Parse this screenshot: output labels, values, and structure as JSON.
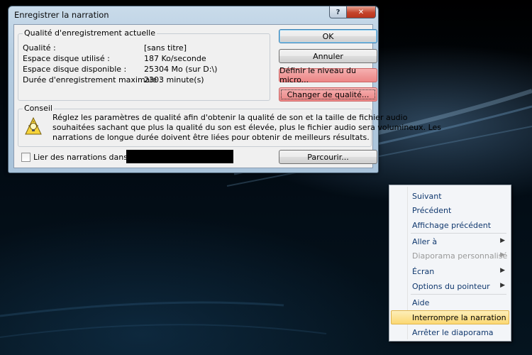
{
  "dialog": {
    "title": "Enregistrer la narration",
    "help_button": "?",
    "close_button": "✕",
    "quality_group": {
      "title": "Qualité d'enregistrement actuelle",
      "rows": [
        {
          "label": "Qualité :",
          "value": "[sans titre]"
        },
        {
          "label": "Espace disque utilisé :",
          "value": "187 Ko/seconde"
        },
        {
          "label": "Espace disque disponible :",
          "value": "25304 Mo (sur D:\\)"
        },
        {
          "label": "Durée d'enregistrement maximale :",
          "value": "2303 minute(s)"
        }
      ]
    },
    "buttons": {
      "ok": "OK",
      "cancel": "Annuler",
      "mic_level": "Définir le niveau du micro...",
      "change_quality": "Changer de qualité...",
      "browse": "Parcourir..."
    },
    "tip_group": {
      "title": "Conseil",
      "text_line1": "Réglez les paramètres de qualité afin d'obtenir la qualité de son et la taille de fichier audio",
      "text_line2": "souhaitées sachant que plus la qualité du son est élevée, plus le fichier audio sera volumineux. Les",
      "text_line3": "narrations de longue durée doivent être liées pour obtenir de meilleurs résultats."
    },
    "link_checkbox_label": "Lier des narrations dans :",
    "link_checkbox_checked": false
  },
  "context_menu": {
    "items": [
      {
        "label": "Suivant",
        "disabled": false,
        "submenu": false
      },
      {
        "label": "Précédent",
        "disabled": false,
        "submenu": false
      },
      {
        "label": "Affichage précédent",
        "disabled": false,
        "submenu": false
      },
      {
        "label": "Aller à",
        "disabled": false,
        "submenu": true
      },
      {
        "label": "Diaporama personnalisé",
        "disabled": true,
        "submenu": true
      },
      {
        "label": "Écran",
        "disabled": false,
        "submenu": true
      },
      {
        "label": "Options du pointeur",
        "disabled": false,
        "submenu": true
      },
      {
        "label": "Aide",
        "disabled": false,
        "submenu": false
      },
      {
        "label": "Interrompre la narration",
        "disabled": false,
        "submenu": false,
        "highlighted": true
      },
      {
        "label": "Arrêter le diaporama",
        "disabled": false,
        "submenu": false
      }
    ]
  },
  "icons": {
    "tip": "lightbulb-icon",
    "submenu": "chevron-right-icon"
  },
  "colors": {
    "highlight": "#fbd873",
    "danger_button": "#f09a9a",
    "menu_text": "#10386e"
  }
}
